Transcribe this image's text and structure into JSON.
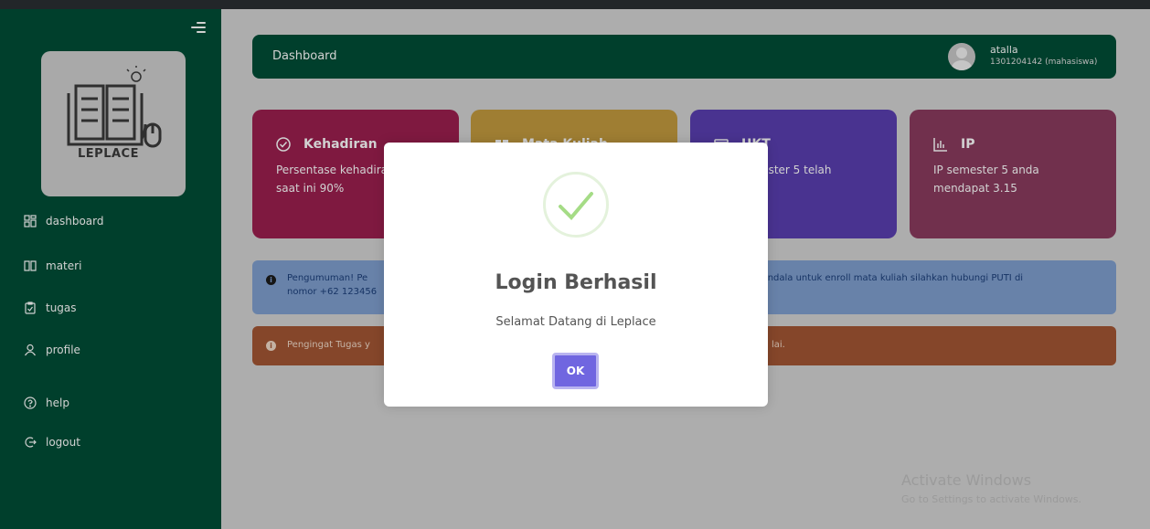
{
  "sidebar": {
    "logo_text": "LEPLACE",
    "items": [
      {
        "label": "dashboard",
        "icon": "grid-icon"
      },
      {
        "label": "materi",
        "icon": "book-icon"
      },
      {
        "label": "tugas",
        "icon": "clipboard-icon"
      },
      {
        "label": "profile",
        "icon": "user-icon"
      },
      {
        "label": "help",
        "icon": "help-icon"
      },
      {
        "label": "logout",
        "icon": "logout-icon"
      }
    ]
  },
  "header": {
    "title": "Dashboard",
    "user_name": "atalla",
    "user_id": "1301204142 (mahasiswa)"
  },
  "cards": [
    {
      "title": "Kehadiran",
      "desc": "Persentase kehadiran anda saat ini 90%",
      "color": "#9b1f4f",
      "icon": "check-circle-icon"
    },
    {
      "title": "Mata Kuliah",
      "desc": "",
      "color": "#c39a3f",
      "icon": "book-open-icon"
    },
    {
      "title": "UKT",
      "desc": "UKT semester 5 telah",
      "color": "#5a3fb0",
      "icon": "wallet-icon"
    },
    {
      "title": "IP",
      "desc": "IP semester 5 anda mendapat 3.15",
      "color": "#8a3b5e",
      "icon": "bar-chart-icon"
    }
  ],
  "alerts": {
    "info_left_1": "Pengumuman! Pe",
    "info_left_2": "nomor +62 123456",
    "info_right": "rkendala untuk enroll mata kuliah silahkan hubungi PUTI di",
    "warn_left": "Pengingat Tugas y",
    "warn_right": "lai."
  },
  "modal": {
    "title": "Login Berhasil",
    "text": "Selamat Datang di Leplace",
    "ok_label": "OK"
  },
  "watermark": {
    "line1": "Activate Windows",
    "line2": "Go to Settings to activate Windows."
  }
}
